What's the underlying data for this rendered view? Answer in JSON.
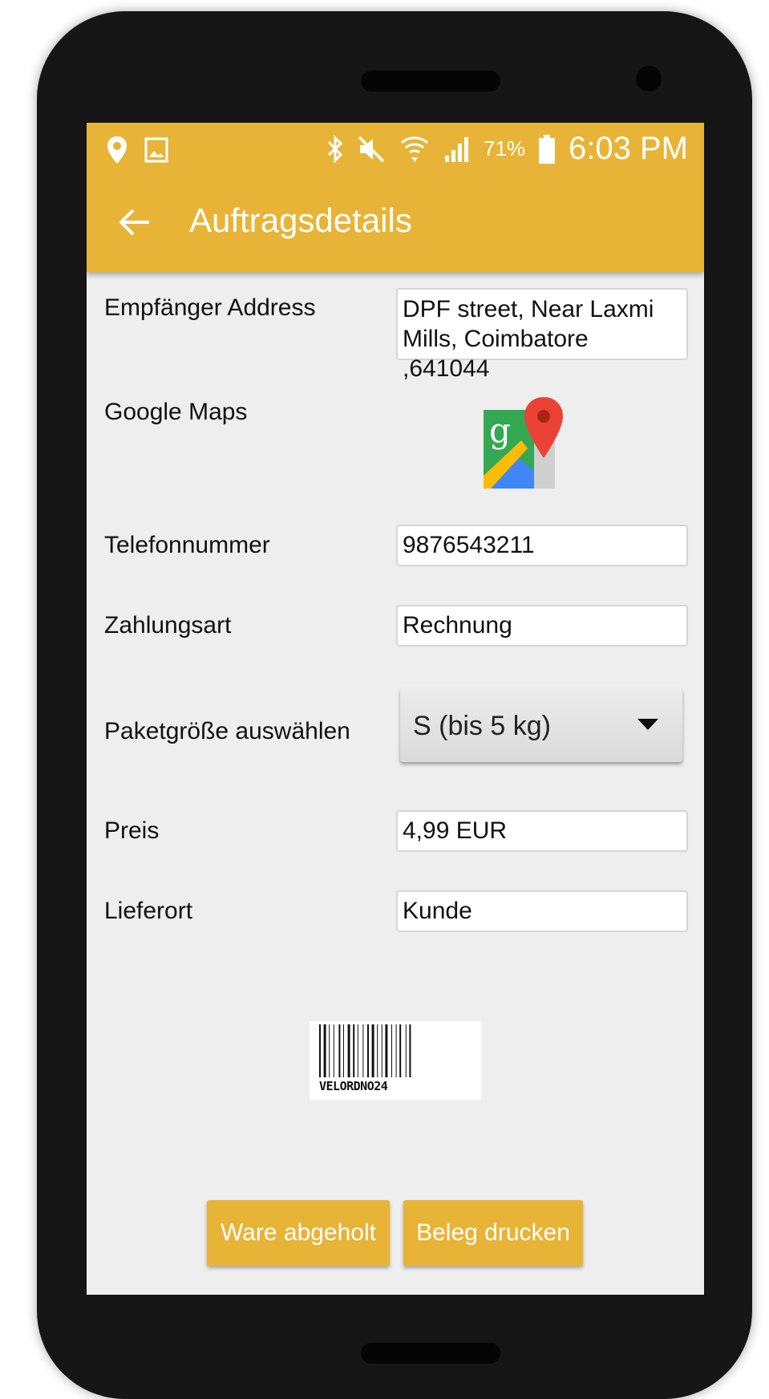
{
  "status_bar": {
    "battery_percent": "71%",
    "time": "6:03 PM",
    "icons": [
      "location-icon",
      "image-icon",
      "bluetooth-icon",
      "mute-icon",
      "wifi-icon",
      "signal-icon",
      "battery-icon"
    ]
  },
  "toolbar": {
    "title": "Auftragsdetails",
    "back_icon": "arrow-back-icon"
  },
  "form": {
    "address_label": "Empfänger Address",
    "address_value_line1": "DPF street, Near Laxmi",
    "address_value_line2": "Mills, Coimbatore ,641044",
    "maps_label": "Google Maps",
    "maps_icon": "google-maps-icon",
    "phone_label": "Telefonnummer",
    "phone_value": "9876543211",
    "payment_label": "Zahlungsart",
    "payment_value": "Rechnung",
    "package_label": "Paketgröße auswählen",
    "package_value": "S (bis 5 kg)",
    "price_label": "Preis",
    "price_value": "4,99 EUR",
    "location_label": "Lieferort",
    "location_value": "Kunde"
  },
  "barcode": {
    "code": "VELORDNO24"
  },
  "actions": {
    "picked_up_label": "Ware abgeholt",
    "print_receipt_label": "Beleg drucken"
  },
  "colors": {
    "accent": "#e8b437",
    "background": "#eeeeee",
    "phone_body": "#161616"
  }
}
